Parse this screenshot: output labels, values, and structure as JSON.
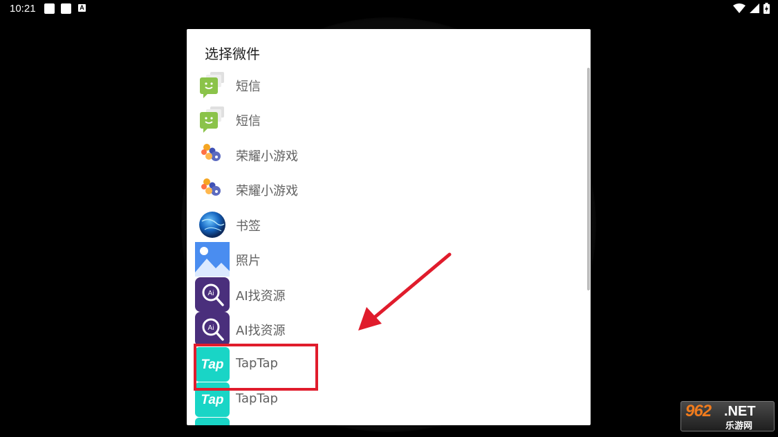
{
  "status_bar": {
    "time": "10:21",
    "indicator_a": "A",
    "icons": [
      "notification-square-icon",
      "notification-square-icon",
      "app-a-icon",
      "wifi-icon",
      "signal-icon",
      "battery-icon"
    ]
  },
  "dialog": {
    "title": "选择微件",
    "items": [
      {
        "label": "短信",
        "icon": "sms-icon"
      },
      {
        "label": "短信",
        "icon": "sms-icon"
      },
      {
        "label": "荣耀小游戏",
        "icon": "honor-minigame-icon"
      },
      {
        "label": "荣耀小游戏",
        "icon": "honor-minigame-icon"
      },
      {
        "label": "书签",
        "icon": "bookmark-globe-icon"
      },
      {
        "label": "照片",
        "icon": "photos-icon"
      },
      {
        "label": "AI找资源",
        "icon": "ai-search-icon"
      },
      {
        "label": "AI找资源",
        "icon": "ai-search-icon"
      },
      {
        "label": "TapTap",
        "icon": "taptap-icon"
      },
      {
        "label": "TapTap",
        "icon": "taptap-icon"
      }
    ]
  },
  "annotation": {
    "highlight_color": "#e01c2c"
  },
  "watermark": {
    "main": "962",
    "net": ".NET",
    "sub": "乐游网"
  },
  "colors": {
    "accent_red": "#e01c2c",
    "taptap_teal": "#19d5c6",
    "ai_purple": "#4a2f7c",
    "sms_green": "#8bc34a"
  }
}
